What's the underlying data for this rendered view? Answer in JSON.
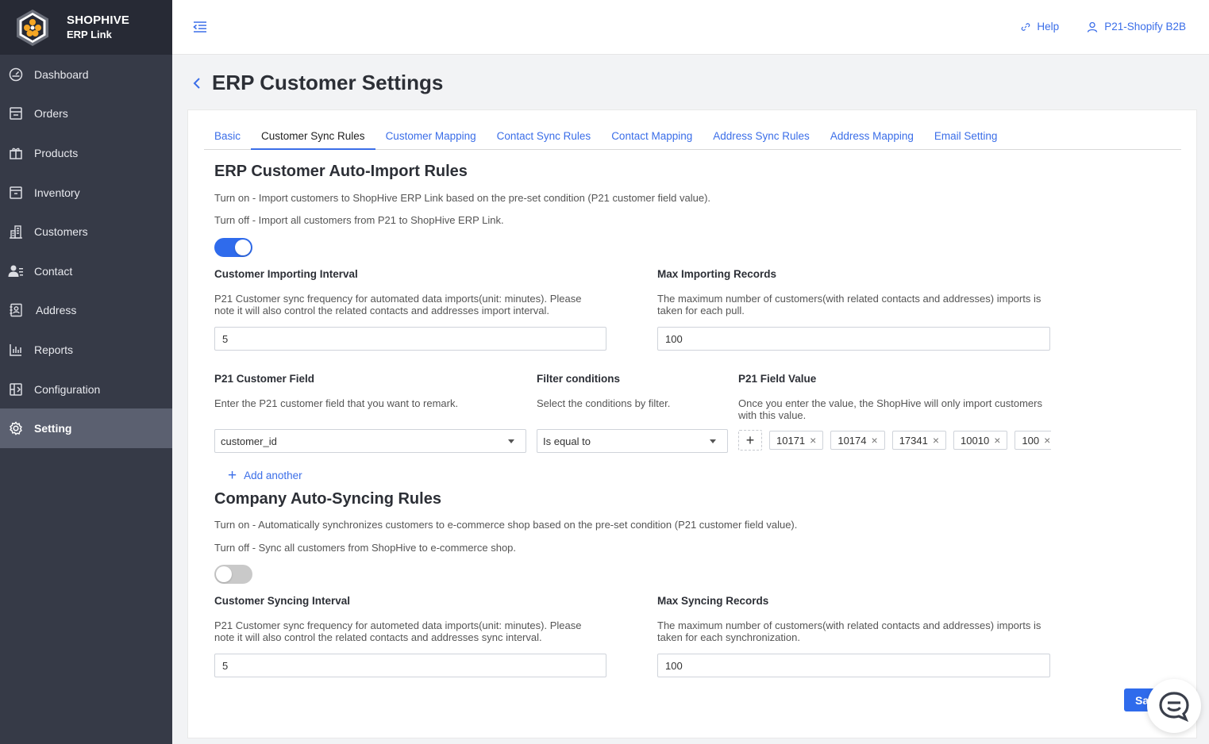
{
  "brand": {
    "title": "SHOPHIVE",
    "subtitle": "ERP Link"
  },
  "sidebar": {
    "items": [
      {
        "label": "Dashboard",
        "icon": "dashboard-icon"
      },
      {
        "label": "Orders",
        "icon": "orders-icon"
      },
      {
        "label": "Products",
        "icon": "gift-box-icon"
      },
      {
        "label": "Inventory",
        "icon": "archive-icon"
      },
      {
        "label": "Customers",
        "icon": "building-icon"
      },
      {
        "label": "Contact",
        "icon": "contact-icon"
      },
      {
        "label": "Address",
        "icon": "address-book-icon"
      },
      {
        "label": "Reports",
        "icon": "bar-chart-icon"
      },
      {
        "label": "Configuration",
        "icon": "configuration-icon"
      },
      {
        "label": "Setting",
        "icon": "gear-icon"
      }
    ],
    "active": "Setting"
  },
  "header": {
    "help_label": "Help",
    "account_label": "P21-Shopify B2B"
  },
  "page": {
    "title": "ERP Customer Settings"
  },
  "tabs": [
    {
      "label": "Basic"
    },
    {
      "label": "Customer Sync Rules"
    },
    {
      "label": "Customer Mapping"
    },
    {
      "label": "Contact Sync Rules"
    },
    {
      "label": "Contact Mapping"
    },
    {
      "label": "Address Sync Rules"
    },
    {
      "label": "Address Mapping"
    },
    {
      "label": "Email Setting"
    }
  ],
  "import_rules": {
    "title": "ERP Customer Auto-Import Rules",
    "turn_on_text": "Turn on - Import customers to ShopHive ERP Link based on the pre-set condition (P21 customer field value).",
    "turn_off_text": "Turn off - Import all customers from P21 to ShopHive ERP Link.",
    "enabled": true,
    "interval_label": "Customer Importing Interval",
    "interval_desc": "P21 Customer sync frequency for automated data imports(unit: minutes). Please note it will also control the related contacts and addresses import interval.",
    "interval_value": "5",
    "max_label": "Max Importing Records",
    "max_desc": "The maximum number of customers(with related contacts and addresses) imports is taken for each pull.",
    "max_value": "100",
    "field_label": "P21 Customer Field",
    "field_desc": "Enter the P21 customer field that you want to remark.",
    "field_value": "customer_id",
    "filter_label": "Filter conditions",
    "filter_desc": "Select the conditions by filter.",
    "filter_value": "Is equal to",
    "value_label": "P21 Field Value",
    "value_desc": "Once you enter the value, the ShopHive will only import customers with this value.",
    "value_tags": [
      "10171",
      "10174",
      "17341",
      "10010",
      "100"
    ],
    "add_another_label": "Add another"
  },
  "sync_rules": {
    "title": "Company Auto-Syncing Rules",
    "turn_on_text": "Turn on - Automatically synchronizes customers to e-commerce shop based on the pre-set condition (P21 customer field value).",
    "turn_off_text": "Turn off - Sync all customers from ShopHive to e-commerce shop.",
    "enabled": false,
    "interval_label": "Customer Syncing Interval",
    "interval_desc": "P21 Customer sync frequency for autometed data imports(unit: minutes). Please note it will also control the related contacts and addresses sync interval.",
    "interval_value": "5",
    "max_label": "Max Syncing Records",
    "max_desc": "The maximum number of customers(with related contacts and addresses) imports is taken for each synchronization.",
    "max_value": "100"
  },
  "save_label": "Sa",
  "colors": {
    "accent": "#2f6bec",
    "sidebar": "#363a47",
    "sidebar_active": "#5b6070",
    "brand_bg": "#272a35"
  }
}
